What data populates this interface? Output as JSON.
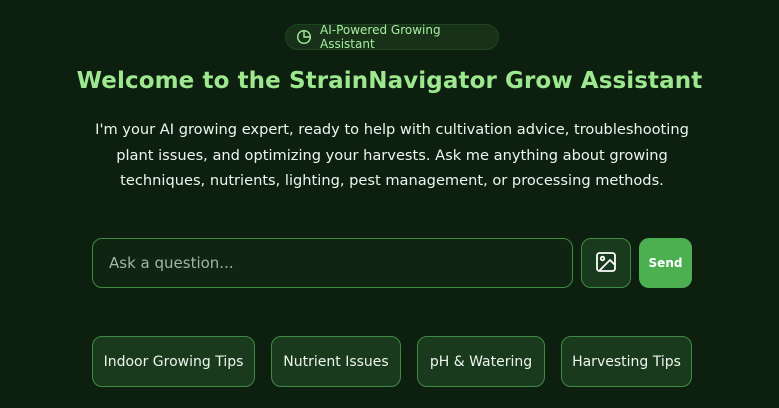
{
  "badge": {
    "icon": "pie-chart-icon",
    "label": "AI-Powered Growing Assistant"
  },
  "header": {
    "title": "Welcome to the StrainNavigator Grow Assistant",
    "description": "I'm your AI growing expert, ready to help with cultivation advice, troubleshooting plant issues, and optimizing your harvests. Ask me anything about growing techniques, nutrients, lighting, pest management, or processing methods."
  },
  "search": {
    "placeholder": "Ask a question...",
    "value": "",
    "image_button_icon": "image-icon",
    "send_label": "Send"
  },
  "suggestions": [
    {
      "label": "Indoor Growing Tips"
    },
    {
      "label": "Nutrient Issues"
    },
    {
      "label": "pH & Watering"
    },
    {
      "label": "Harvesting Tips"
    }
  ],
  "colors": {
    "background": "#0d200f",
    "accent": "#9de88f",
    "send_button": "#4caf50",
    "border": "#3f8a43"
  }
}
